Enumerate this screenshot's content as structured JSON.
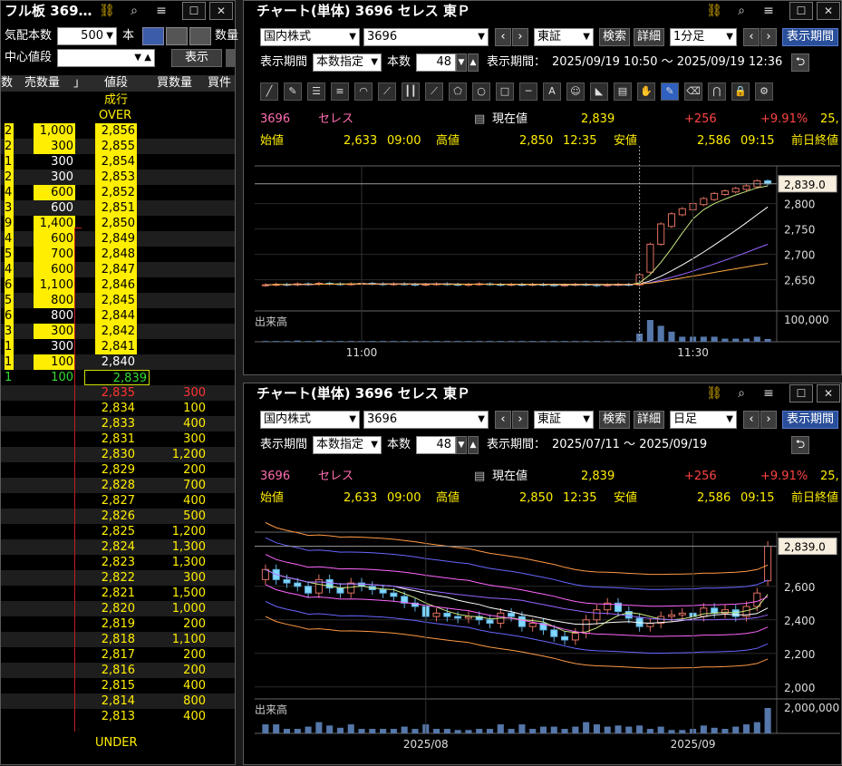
{
  "orderbook": {
    "title": "フル板 369…",
    "tick_label": "気配本数",
    "tick_value": "500",
    "unit_label": "本",
    "qty_label": "数量",
    "center_label": "中心値段",
    "center_value": "",
    "show_button": "表示",
    "col_headers": {
      "sell_count": "数",
      "sell_qty": "売数量",
      "sell_mark": "」",
      "price": "値段",
      "buy_qty": "買数量",
      "buy_count": "買件"
    },
    "market_label": "成行",
    "over_label": "OVER",
    "under_label": "UNDER",
    "asks": [
      {
        "count": "2",
        "qty": "1,000",
        "price": "2,856",
        "qty_hl": true,
        "price_hl": true
      },
      {
        "count": "2",
        "qty": "300",
        "price": "2,855",
        "qty_hl": true,
        "price_hl": true
      },
      {
        "count": "1",
        "qty": "300",
        "price": "2,854",
        "qty_hl": false,
        "price_hl": true
      },
      {
        "count": "2",
        "qty": "300",
        "price": "2,853",
        "qty_hl": false,
        "price_hl": true
      },
      {
        "count": "4",
        "qty": "600",
        "price": "2,852",
        "qty_hl": true,
        "price_hl": true
      },
      {
        "count": "3",
        "qty": "600",
        "price": "2,851",
        "qty_hl": false,
        "price_hl": true
      },
      {
        "count": "9",
        "qty": "1,400",
        "price": "2,850",
        "qty_hl": true,
        "price_hl": true
      },
      {
        "count": "4",
        "qty": "600",
        "price": "2,849",
        "qty_hl": true,
        "price_hl": true
      },
      {
        "count": "5",
        "qty": "700",
        "price": "2,848",
        "qty_hl": true,
        "price_hl": true
      },
      {
        "count": "4",
        "qty": "600",
        "price": "2,847",
        "qty_hl": true,
        "price_hl": true
      },
      {
        "count": "6",
        "qty": "1,100",
        "price": "2,846",
        "qty_hl": true,
        "price_hl": true
      },
      {
        "count": "5",
        "qty": "800",
        "price": "2,845",
        "qty_hl": true,
        "price_hl": true
      },
      {
        "count": "6",
        "qty": "800",
        "price": "2,844",
        "qty_hl": false,
        "price_hl": true
      },
      {
        "count": "3",
        "qty": "300",
        "price": "2,842",
        "qty_hl": true,
        "price_hl": true
      },
      {
        "count": "1",
        "qty": "300",
        "price": "2,841",
        "qty_hl": false,
        "price_hl": true
      },
      {
        "count": "1",
        "qty": "100",
        "price": "2,840",
        "qty_hl": true,
        "price_hl": false
      },
      {
        "count": "1",
        "qty": "100",
        "price": "2,839",
        "qty_hl": false,
        "price_hl": false,
        "green": true
      }
    ],
    "bids": [
      {
        "price": "2,835",
        "qty": "300",
        "red": true
      },
      {
        "price": "2,834",
        "qty": "100"
      },
      {
        "price": "2,833",
        "qty": "400"
      },
      {
        "price": "2,831",
        "qty": "300"
      },
      {
        "price": "2,830",
        "qty": "1,200"
      },
      {
        "price": "2,829",
        "qty": "200"
      },
      {
        "price": "2,828",
        "qty": "700"
      },
      {
        "price": "2,827",
        "qty": "400"
      },
      {
        "price": "2,826",
        "qty": "500"
      },
      {
        "price": "2,825",
        "qty": "1,200"
      },
      {
        "price": "2,824",
        "qty": "1,300"
      },
      {
        "price": "2,823",
        "qty": "1,300"
      },
      {
        "price": "2,822",
        "qty": "300"
      },
      {
        "price": "2,821",
        "qty": "1,500"
      },
      {
        "price": "2,820",
        "qty": "1,000"
      },
      {
        "price": "2,819",
        "qty": "200"
      },
      {
        "price": "2,818",
        "qty": "1,100"
      },
      {
        "price": "2,817",
        "qty": "200"
      },
      {
        "price": "2,816",
        "qty": "200"
      },
      {
        "price": "2,815",
        "qty": "400"
      },
      {
        "price": "2,814",
        "qty": "800"
      },
      {
        "price": "2,813",
        "qty": "400"
      }
    ]
  },
  "chart1": {
    "title": "チャート(単体) 3696 セレス 東Ｐ",
    "market": "国内株式",
    "code": "3696",
    "exchange": "東証",
    "search_btn": "検索",
    "detail_btn": "詳細",
    "interval": "1分足",
    "period_btn": "表示期間",
    "period_label": "表示期間",
    "period_mode": "本数指定",
    "count_label": "本数",
    "count_value": "48",
    "range_label": "表示期間：",
    "range_value": "2025/09/19 10:50 ～ 2025/09/19 12:36",
    "stock_code": "3696",
    "stock_name": "セレス",
    "current_label": "現在値",
    "current_value": "2,839",
    "change": "+256",
    "change_pct": "+9.91%",
    "trunc": "25,",
    "open_label": "始値",
    "open_value": "2,633",
    "open_time": "09:00",
    "high_label": "高値",
    "high_value": "2,850",
    "high_time": "12:35",
    "low_label": "安値",
    "low_value": "2,586",
    "low_time": "09:15",
    "prev_label": "前日終値",
    "price_tag": "2,839.0",
    "volume_label": "出来高"
  },
  "chart2": {
    "title": "チャート(単体) 3696 セレス 東Ｐ",
    "market": "国内株式",
    "code": "3696",
    "exchange": "東証",
    "search_btn": "検索",
    "detail_btn": "詳細",
    "interval": "日足",
    "period_btn": "表示期間",
    "period_label": "表示期間",
    "period_mode": "本数指定",
    "count_label": "本数",
    "count_value": "48",
    "range_label": "表示期間：",
    "range_value": "2025/07/11 ～ 2025/09/19",
    "stock_code": "3696",
    "stock_name": "セレス",
    "current_label": "現在値",
    "current_value": "2,839",
    "change": "+256",
    "change_pct": "+9.91%",
    "trunc": "25,",
    "open_label": "始値",
    "open_value": "2,633",
    "open_time": "09:00",
    "high_label": "高値",
    "high_value": "2,850",
    "high_time": "12:35",
    "low_label": "安値",
    "low_value": "2,586",
    "low_time": "09:15",
    "prev_label": "前日終値",
    "price_tag": "2,839.0",
    "volume_label": "出来高"
  },
  "chart_data": [
    {
      "type": "line",
      "price_ticks": [
        "2,800",
        "2,750",
        "2,700",
        "2,650"
      ],
      "price_tick_values": [
        2800,
        2750,
        2700,
        2650
      ],
      "volume_ticks": [
        "100,000"
      ],
      "x_ticks": [
        "11:00",
        "11:30"
      ],
      "ylim": [
        2610,
        2860
      ],
      "closes": [
        2640,
        2641,
        2640,
        2642,
        2641,
        2643,
        2642,
        2641,
        2642,
        2643,
        2642,
        2641,
        2642,
        2641,
        2640,
        2641,
        2642,
        2641,
        2640,
        2641,
        2642,
        2641,
        2640,
        2641,
        2640,
        2641,
        2640,
        2639,
        2640,
        2641,
        2640,
        2639,
        2640,
        2641,
        2640,
        2660,
        2720,
        2760,
        2780,
        2790,
        2800,
        2810,
        2820,
        2825,
        2830,
        2835,
        2845,
        2839
      ],
      "opens": [
        2639,
        2640,
        2641,
        2640,
        2642,
        2641,
        2643,
        2642,
        2641,
        2642,
        2643,
        2642,
        2641,
        2642,
        2641,
        2640,
        2641,
        2642,
        2641,
        2640,
        2641,
        2642,
        2641,
        2640,
        2641,
        2640,
        2641,
        2640,
        2639,
        2640,
        2641,
        2640,
        2639,
        2640,
        2641,
        2640,
        2665,
        2720,
        2755,
        2778,
        2788,
        2798,
        2808,
        2818,
        2823,
        2828,
        2833,
        2845
      ]
    },
    {
      "type": "line",
      "price_ticks": [
        "2,600",
        "2,400",
        "2,200",
        "2,000"
      ],
      "price_tick_values": [
        2600,
        2400,
        2200,
        2000
      ],
      "volume_ticks": [
        "2,000,000"
      ],
      "x_ticks": [
        "2025/08",
        "2025/09"
      ],
      "ylim": [
        1950,
        2880
      ],
      "closes": [
        2700,
        2640,
        2620,
        2600,
        2560,
        2640,
        2590,
        2560,
        2620,
        2600,
        2580,
        2560,
        2540,
        2500,
        2480,
        2420,
        2440,
        2420,
        2410,
        2420,
        2400,
        2380,
        2440,
        2420,
        2360,
        2380,
        2340,
        2300,
        2280,
        2320,
        2400,
        2460,
        2500,
        2450,
        2410,
        2360,
        2380,
        2420,
        2430,
        2440,
        2420,
        2470,
        2440,
        2460,
        2420,
        2480,
        2560,
        2839
      ],
      "opens": [
        2640,
        2700,
        2640,
        2620,
        2600,
        2560,
        2640,
        2590,
        2560,
        2620,
        2600,
        2580,
        2560,
        2540,
        2500,
        2480,
        2420,
        2440,
        2420,
        2410,
        2420,
        2400,
        2380,
        2440,
        2420,
        2360,
        2380,
        2340,
        2300,
        2280,
        2320,
        2400,
        2460,
        2500,
        2450,
        2410,
        2360,
        2380,
        2420,
        2430,
        2440,
        2420,
        2470,
        2440,
        2460,
        2420,
        2480,
        2633
      ]
    }
  ]
}
